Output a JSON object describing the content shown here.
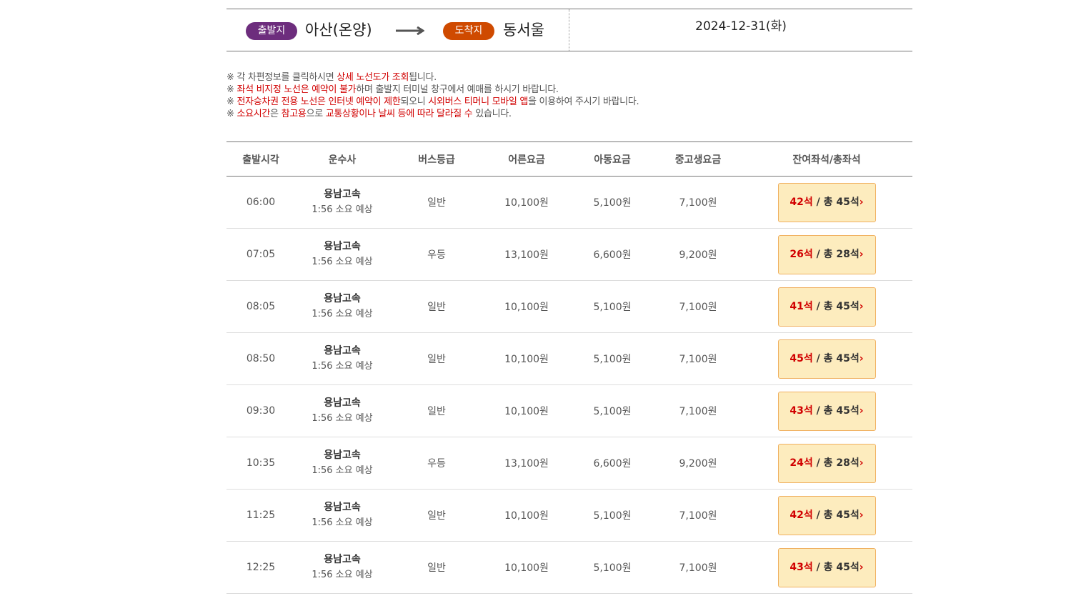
{
  "route": {
    "depart_badge": "출발지",
    "depart_terminal": "아산(온양)",
    "arrive_badge": "도착지",
    "arrive_terminal": "동서울",
    "date": "2024-12-31(화)",
    "arrow_icon": "right-arrow-icon",
    "colors": {
      "depart_badge": "#6d2d7d",
      "arrive_badge": "#cf4a00",
      "highlight": "#d10000",
      "seat_button_bg": "#fdecbe"
    }
  },
  "notices": [
    {
      "parts": [
        {
          "t": "※ 각 차편정보를 클릭하시면 ",
          "hl": false
        },
        {
          "t": "상세 노선도가 조회",
          "hl": true
        },
        {
          "t": "됩니다.",
          "hl": false
        }
      ]
    },
    {
      "parts": [
        {
          "t": "※ ",
          "hl": false
        },
        {
          "t": "좌석 비지정 노선은 예약이 불가",
          "hl": true
        },
        {
          "t": "하며 출발지 터미널 창구에서 예매를 하시기 바랍니다.",
          "hl": false
        }
      ]
    },
    {
      "parts": [
        {
          "t": "※ ",
          "hl": false
        },
        {
          "t": "전자승차권 전용 노선은 인터넷 예약이 제한",
          "hl": true
        },
        {
          "t": "되오니 ",
          "hl": false
        },
        {
          "t": "시외버스 티머니 모바일 앱",
          "hl": true
        },
        {
          "t": "을 이용하여 주시기 바랍니다.",
          "hl": false
        }
      ]
    },
    {
      "parts": [
        {
          "t": "※ ",
          "hl": false
        },
        {
          "t": "소요시간",
          "hl": true
        },
        {
          "t": "은 ",
          "hl": false
        },
        {
          "t": "참고용",
          "hl": true
        },
        {
          "t": "으로 ",
          "hl": false
        },
        {
          "t": "교통상황이나 날씨 등에 따라 달라질 수",
          "hl": true
        },
        {
          "t": " 있습니다.",
          "hl": false
        }
      ]
    }
  ],
  "table": {
    "headers": [
      "출발시각",
      "운수사",
      "버스등급",
      "어른요금",
      "아동요금",
      "중고생요금",
      "잔여좌석/총좌석"
    ],
    "rows": [
      {
        "time": "06:00",
        "operator": "용남고속",
        "duration": "1:56 소요 예상",
        "grade": "일반",
        "adult": "10,100원",
        "child": "5,100원",
        "youth": "7,100원",
        "remain": "42석",
        "total": " / 총 45석"
      },
      {
        "time": "07:05",
        "operator": "용남고속",
        "duration": "1:56 소요 예상",
        "grade": "우등",
        "adult": "13,100원",
        "child": "6,600원",
        "youth": "9,200원",
        "remain": "26석",
        "total": " / 총 28석"
      },
      {
        "time": "08:05",
        "operator": "용남고속",
        "duration": "1:56 소요 예상",
        "grade": "일반",
        "adult": "10,100원",
        "child": "5,100원",
        "youth": "7,100원",
        "remain": "41석",
        "total": " / 총 45석"
      },
      {
        "time": "08:50",
        "operator": "용남고속",
        "duration": "1:56 소요 예상",
        "grade": "일반",
        "adult": "10,100원",
        "child": "5,100원",
        "youth": "7,100원",
        "remain": "45석",
        "total": " / 총 45석"
      },
      {
        "time": "09:30",
        "operator": "용남고속",
        "duration": "1:56 소요 예상",
        "grade": "일반",
        "adult": "10,100원",
        "child": "5,100원",
        "youth": "7,100원",
        "remain": "43석",
        "total": " / 총 45석"
      },
      {
        "time": "10:35",
        "operator": "용남고속",
        "duration": "1:56 소요 예상",
        "grade": "우등",
        "adult": "13,100원",
        "child": "6,600원",
        "youth": "9,200원",
        "remain": "24석",
        "total": " / 총 28석"
      },
      {
        "time": "11:25",
        "operator": "용남고속",
        "duration": "1:56 소요 예상",
        "grade": "일반",
        "adult": "10,100원",
        "child": "5,100원",
        "youth": "7,100원",
        "remain": "42석",
        "total": " / 총 45석"
      },
      {
        "time": "12:25",
        "operator": "용남고속",
        "duration": "1:56 소요 예상",
        "grade": "일반",
        "adult": "10,100원",
        "child": "5,100원",
        "youth": "7,100원",
        "remain": "43석",
        "total": " / 총 45석"
      }
    ],
    "seat_button_icon": "chevron-right-icon"
  }
}
